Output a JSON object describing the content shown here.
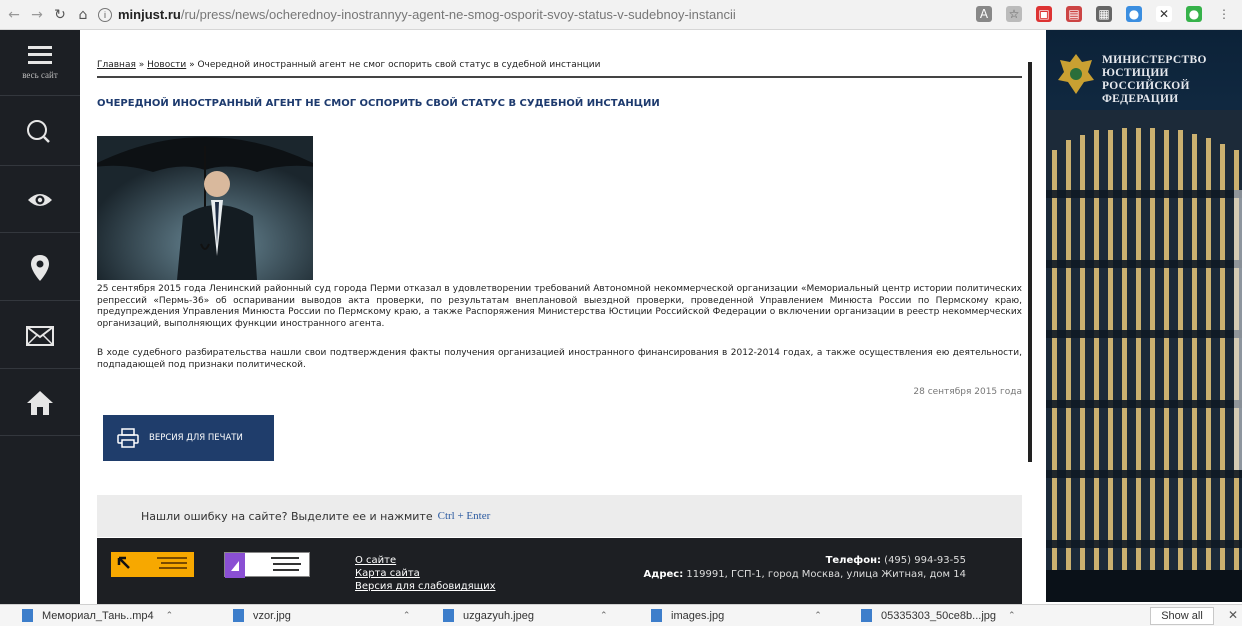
{
  "browser": {
    "url_host": "minjust.ru",
    "url_path": "/ru/press/news/ocherednoy-inostrannyy-agent-ne-smog-osporit-svoy-status-v-sudebnoy-instancii"
  },
  "sidebar": {
    "menu_label": "весь сайт"
  },
  "breadcrumb": {
    "home": "Главная",
    "sep1": " » ",
    "news": "Новости",
    "sep2": " » ",
    "current": "Очередной иностранный агент не смог оспорить свой статус в судебной инстанции"
  },
  "article": {
    "title": "ОЧЕРЕДНОЙ ИНОСТРАННЫЙ АГЕНТ НЕ СМОГ ОСПОРИТЬ СВОЙ СТАТУС В СУДЕБНОЙ ИНСТАНЦИИ",
    "paragraph1": "25 сентября 2015 года Ленинский районный суд города Перми отказал в удовлетворении требований Автономной некоммерческой организации «Мемориальный центр истории политических репрессий «Пермь-36» об оспаривании выводов акта проверки, по результатам внеплановой выездной проверки, проведенной Управлением Минюста России по Пермскому краю, предупреждения Управления Минюста России по Пермскому краю, а также Распоряжения Министерства Юстиции Российской Федерации о включении организации в реестр некоммерческих организаций, выполняющих функции иностранного агента.",
    "paragraph2": "В ходе судебного разбирательства нашли свои подтверждения факты получения организацией иностранного финансирования в 2012-2014 годах, а также осуществления ею деятельности, подпадающей под признаки политической.",
    "date": "28 сентября 2015 года",
    "print_label": "версия для печати"
  },
  "error_notice": {
    "text": "Нашли ошибку на сайте? Выделите ее и нажмите",
    "shortcut": "Ctrl + Enter"
  },
  "footer": {
    "links": [
      "О сайте",
      "Карта сайта",
      "Версия для слабовидящих"
    ],
    "phone_label": "Телефон:",
    "phone": "(495) 994-93-55",
    "address_label": "Адрес:",
    "address": "119991, ГСП-1, город Москва, улица Житная, дом 14"
  },
  "banner": {
    "line1": "МИНИСТЕРСТВО",
    "line2": "ЮСТИЦИИ",
    "line3": "РОССИЙСКОЙ",
    "line4": "ФЕДЕРАЦИИ"
  },
  "downloads": {
    "items": [
      "Мемориал_Тань..mp4",
      "vzor.jpg",
      "uzgazyuh.jpeg",
      "images.jpg",
      "05335303_50ce8b...jpg"
    ],
    "show_all": "Show all"
  }
}
